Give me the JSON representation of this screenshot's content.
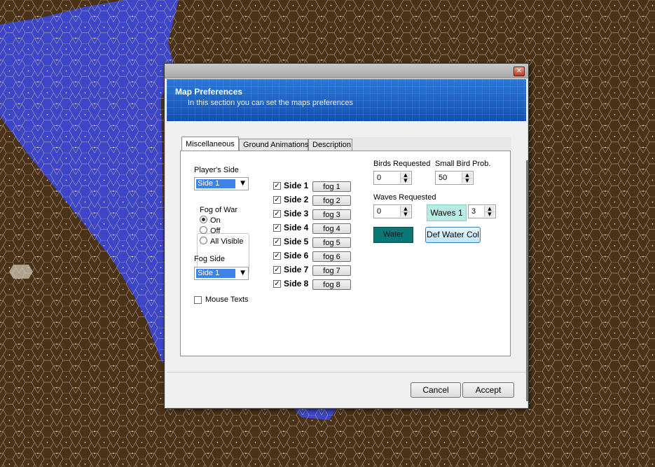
{
  "dialog": {
    "close_glyph": "✕",
    "header_title": "Map Preferences",
    "header_subtitle": "In this section you can set the maps preferences"
  },
  "tabs": [
    {
      "label": "Miscellaneous",
      "active": true
    },
    {
      "label": "Ground Animations",
      "active": false
    },
    {
      "label": "Description",
      "active": false
    }
  ],
  "misc": {
    "players_side_label": "Player's Side",
    "players_side_value": "Side 1",
    "fog_of_war_label": "Fog of War",
    "fog_options": [
      {
        "label": "On",
        "checked": true
      },
      {
        "label": "Off",
        "checked": false
      },
      {
        "label": "All Visible",
        "checked": false
      }
    ],
    "fog_side_label": "Fog Side",
    "fog_side_value": "Side 1",
    "mouse_texts_label": "Mouse Texts",
    "mouse_texts_checked": false,
    "sides": [
      {
        "label": "Side 1",
        "checked": true,
        "fog_label": "fog 1"
      },
      {
        "label": "Side 2",
        "checked": true,
        "fog_label": "fog 2"
      },
      {
        "label": "Side 3",
        "checked": true,
        "fog_label": "fog 3"
      },
      {
        "label": "Side 4",
        "checked": true,
        "fog_label": "fog 4"
      },
      {
        "label": "Side 5",
        "checked": true,
        "fog_label": "fog 5"
      },
      {
        "label": "Side 6",
        "checked": true,
        "fog_label": "fog 6"
      },
      {
        "label": "Side 7",
        "checked": true,
        "fog_label": "fog 7"
      },
      {
        "label": "Side 8",
        "checked": true,
        "fog_label": "fog 8"
      }
    ],
    "birds_requested_label": "Birds Requested",
    "birds_requested_value": "0",
    "small_bird_prob_label": "Small Bird Prob.",
    "small_bird_prob_value": "50",
    "waves_requested_label": "Waves Requested",
    "waves_requested_value": "0",
    "waves_button_label": "Waves 1",
    "waves_number_value": "3",
    "water_label": "Water",
    "water_color": "#0a7777",
    "def_water_col_label": "Def Water Col"
  },
  "footer": {
    "cancel_label": "Cancel",
    "accept_label": "Accept"
  },
  "icons": {
    "dropdown": "▼",
    "spin_up": "▲",
    "spin_down": "▼",
    "check": "✓"
  },
  "colors": {
    "ground": "#4a3218",
    "water": "#3d46c8",
    "header_blue": "#1a5fc2"
  }
}
